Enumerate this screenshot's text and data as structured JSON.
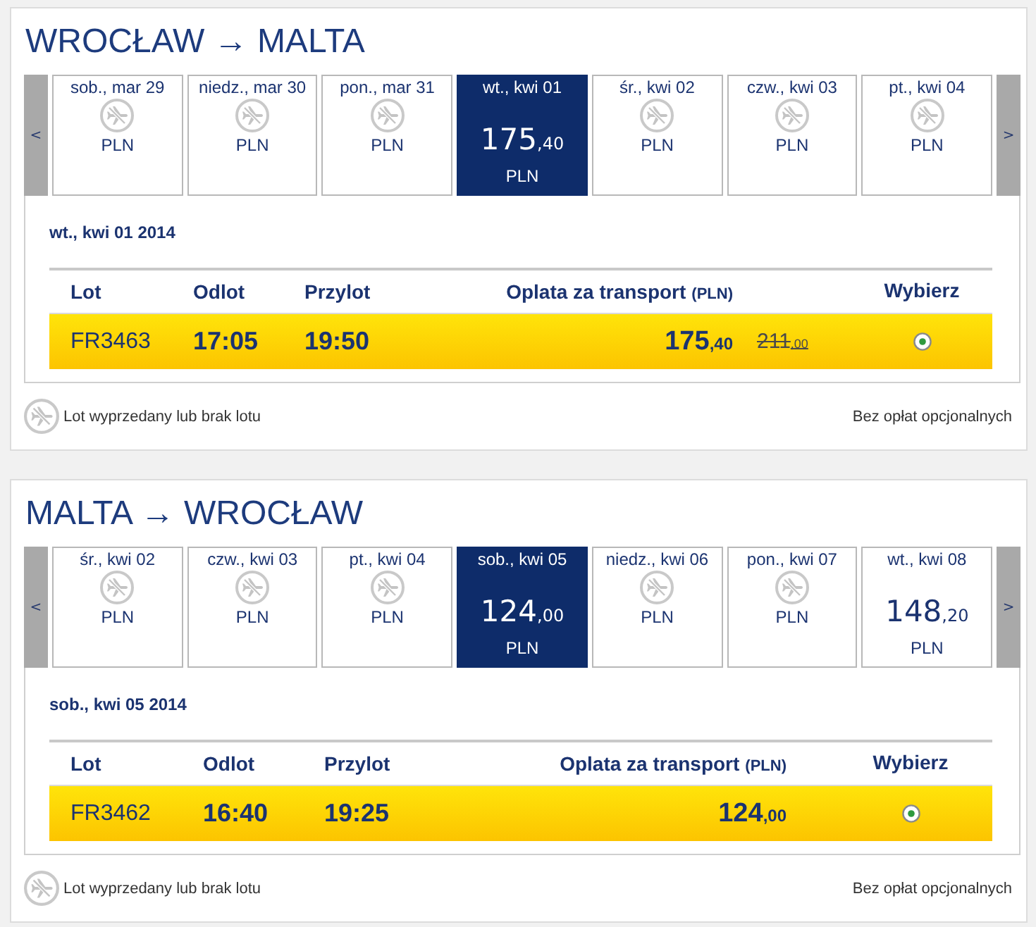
{
  "journeys": [
    {
      "title": "WROCŁAW → MALTA",
      "prev": "<",
      "next": ">",
      "days": [
        {
          "date": "sob., mar 29",
          "kind": "sold_out",
          "currency": "PLN",
          "selected": false
        },
        {
          "date": "niedz., mar 30",
          "kind": "sold_out",
          "currency": "PLN",
          "selected": false
        },
        {
          "date": "pon., mar 31",
          "kind": "sold_out",
          "currency": "PLN",
          "selected": false
        },
        {
          "date": "wt., kwi 01",
          "kind": "fare",
          "fare": {
            "whole": "175",
            "decimals": ",40"
          },
          "currency": "PLN",
          "selected": true
        },
        {
          "date": "śr., kwi 02",
          "kind": "sold_out",
          "currency": "PLN",
          "selected": false
        },
        {
          "date": "czw., kwi 03",
          "kind": "sold_out",
          "currency": "PLN",
          "selected": false
        },
        {
          "date": "pt., kwi 04",
          "kind": "sold_out",
          "currency": "PLN",
          "selected": false
        }
      ],
      "date_heading": "wt., kwi 01 2014",
      "columns": [
        {
          "label": "Lot"
        },
        {
          "label": "Odlot"
        },
        {
          "label": "Przylot"
        },
        {
          "label": "Oplata za transport",
          "unit": "(PLN)"
        },
        {
          "label": "Wybierz"
        }
      ],
      "flights": [
        {
          "number": "FR3463",
          "departure": "17:05",
          "arrival": "19:50",
          "fare": {
            "whole": "175",
            "decimals": ",40"
          },
          "old_fare": {
            "whole": "211",
            "decimals": ",00"
          },
          "selected": true
        }
      ],
      "legend": "Lot wyprzedany lub brak lotu",
      "note": "Bez opłat opcjonalnych"
    },
    {
      "title": "MALTA → WROCŁAW",
      "prev": "<",
      "next": ">",
      "days": [
        {
          "date": "śr., kwi 02",
          "kind": "sold_out",
          "currency": "PLN",
          "selected": false
        },
        {
          "date": "czw., kwi 03",
          "kind": "sold_out",
          "currency": "PLN",
          "selected": false
        },
        {
          "date": "pt., kwi 04",
          "kind": "sold_out",
          "currency": "PLN",
          "selected": false
        },
        {
          "date": "sob., kwi 05",
          "kind": "fare",
          "fare": {
            "whole": "124",
            "decimals": ",00"
          },
          "currency": "PLN",
          "selected": true
        },
        {
          "date": "niedz., kwi 06",
          "kind": "sold_out",
          "currency": "PLN",
          "selected": false
        },
        {
          "date": "pon., kwi 07",
          "kind": "sold_out",
          "currency": "PLN",
          "selected": false
        },
        {
          "date": "wt., kwi 08",
          "kind": "fare",
          "fare": {
            "whole": "148",
            "decimals": ",20"
          },
          "currency": "PLN",
          "selected": false
        }
      ],
      "date_heading": "sob., kwi 05 2014",
      "columns": [
        {
          "label": "Lot"
        },
        {
          "label": "Odlot"
        },
        {
          "label": "Przylot"
        },
        {
          "label": "Oplata za transport",
          "unit": "(PLN)"
        },
        {
          "label": "Wybierz"
        }
      ],
      "flights": [
        {
          "number": "FR3462",
          "departure": "16:40",
          "arrival": "19:25",
          "fare": {
            "whole": "124",
            "decimals": ",00"
          },
          "selected": true
        }
      ],
      "legend": "Lot wyprzedany lub brak lotu",
      "note": "Bez opłat opcjonalnych"
    }
  ]
}
